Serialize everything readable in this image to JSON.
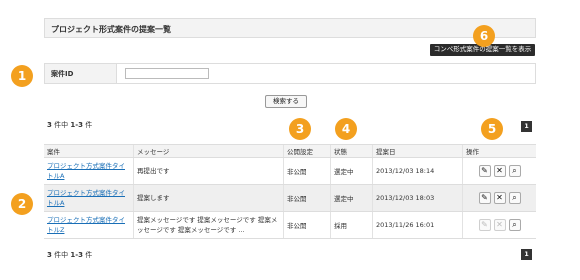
{
  "title": "プロジェクト形式案件の提案一覧",
  "top_button": "コンペ形式案件の提案一覧を表示",
  "search": {
    "label": "案件ID",
    "value": "",
    "button": "検索する"
  },
  "count_top": {
    "prefix": "3",
    "mid": "件中",
    "range": "1-3",
    "suffix": "件"
  },
  "count_bottom": {
    "prefix": "3",
    "mid": "件中",
    "range": "1-3",
    "suffix": "件"
  },
  "pager": "1",
  "columns": [
    "案件",
    "メッセージ",
    "公開設定",
    "状態",
    "提案日",
    "操作"
  ],
  "rows": [
    {
      "project": "プロジェクト方式案件タイトルA",
      "message": "再提出です",
      "visibility": "非公開",
      "status": "選定中",
      "date": "2013/12/03 18:14",
      "edit_enabled": true
    },
    {
      "project": "プロジェクト方式案件タイトルA",
      "message": "提案します",
      "visibility": "非公開",
      "status": "選定中",
      "date": "2013/12/03 18:03",
      "edit_enabled": true
    },
    {
      "project": "プロジェクト方式案件タイトルZ",
      "message": "提案メッセージです 提案メッセージです 提案メッセージです 提案メッセージです ...",
      "visibility": "非公開",
      "status": "採用",
      "date": "2013/11/26 16:01",
      "edit_enabled": false
    }
  ],
  "badges": [
    "1",
    "2",
    "3",
    "4",
    "5",
    "6"
  ],
  "colors": {
    "badge": "#f3a01f",
    "link": "#1a6fb7",
    "dark_button": "#2b2b2b"
  },
  "icons": {
    "edit": "pencil-icon",
    "cancel": "cross-icon",
    "view": "magnifier-icon"
  }
}
